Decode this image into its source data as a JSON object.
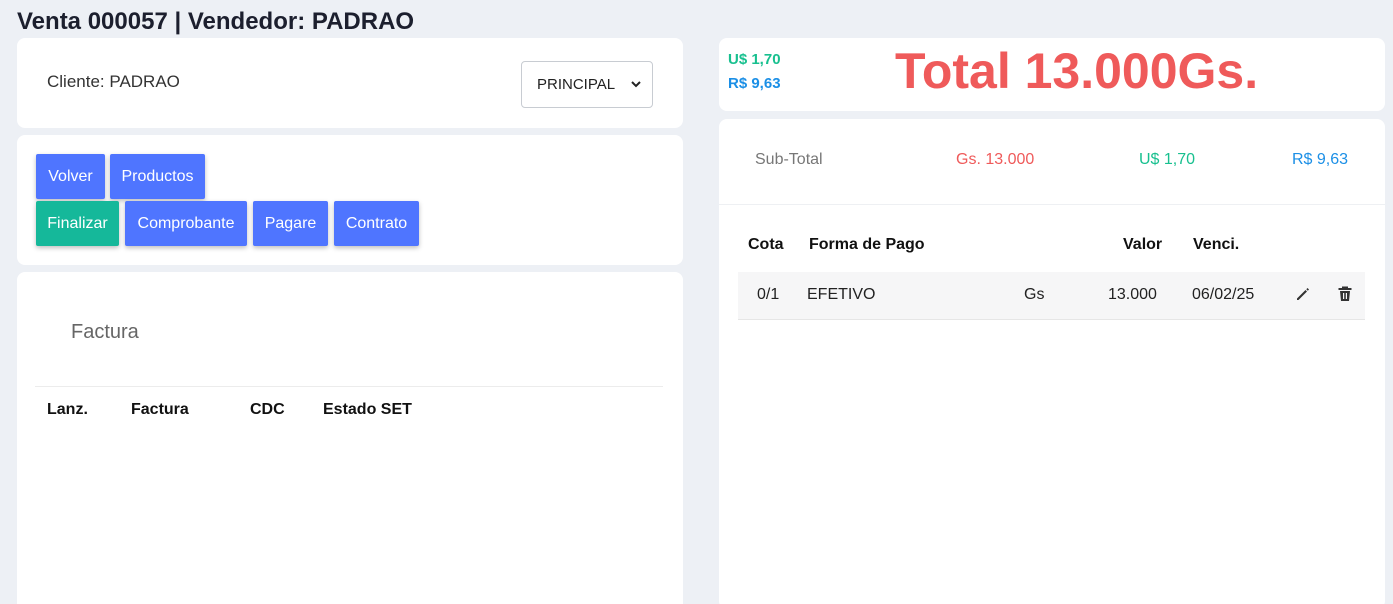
{
  "header": {
    "title": "Venta 000057 | Vendedor: PADRAO"
  },
  "client": {
    "label": "Cliente: PADRAO",
    "select_value": "PRINCIPAL"
  },
  "actions": {
    "volver": "Volver",
    "productos": "Productos",
    "finalizar": "Finalizar",
    "comprobante": "Comprobante",
    "pagare": "Pagare",
    "contrato": "Contrato"
  },
  "invoice": {
    "title": "Factura",
    "columns": [
      "Lanz.",
      "Factura",
      "CDC",
      "Estado SET"
    ]
  },
  "totals": {
    "usd": "U$ 1,70",
    "brl": "R$ 9,63",
    "total": "Total 13.000Gs."
  },
  "subtotal": {
    "label": "Sub-Total",
    "gs": "Gs. 13.000",
    "usd": "U$ 1,70",
    "brl": "R$ 9,63"
  },
  "payments": {
    "columns": [
      "Cota",
      "Forma de Pago",
      "Valor",
      "Venci."
    ],
    "rows": [
      {
        "cota": "0/1",
        "forma": "EFETIVO",
        "moneda": "Gs",
        "valor": "13.000",
        "venci": "06/02/25"
      }
    ]
  },
  "colors": {
    "accent": "#4f75ff",
    "success": "#15b89a",
    "total": "#ef5a5a",
    "usd": "#18c08f",
    "brl": "#1b8fe6"
  },
  "icons": [
    "chevron-down-icon",
    "pencil-icon",
    "trash-icon"
  ]
}
